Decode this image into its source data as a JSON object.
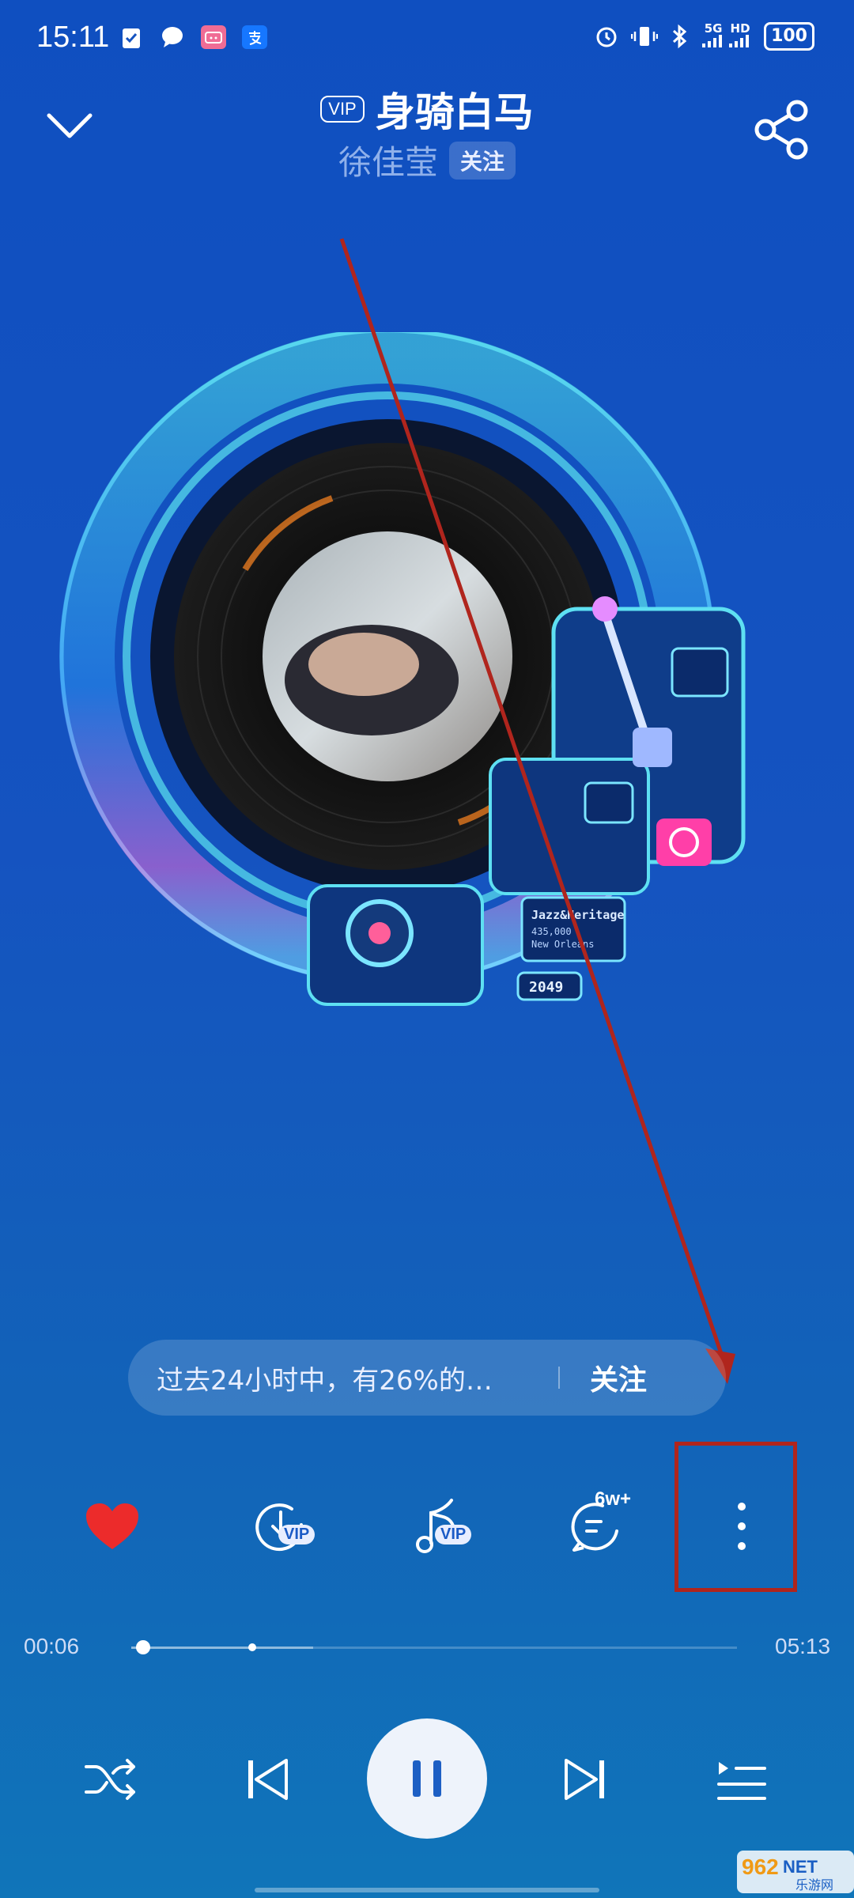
{
  "status_bar": {
    "time": "15:11",
    "network": "5G",
    "hd": "HD",
    "battery": "100"
  },
  "header": {
    "vip_badge": "VIP",
    "title": "身骑白马",
    "artist": "徐佳莹",
    "follow_label": "关注"
  },
  "info_bar": {
    "text": "过去24小时中，有26%的…",
    "follow_label": "关注"
  },
  "actions": {
    "download_vip": "VIP",
    "ringtone_vip": "VIP",
    "comment_count": "6w+"
  },
  "progress": {
    "current": "00:06",
    "total": "05:13",
    "played_fraction": 0.019,
    "buffered_fraction": 0.3
  },
  "album_labels": {
    "jazz_title": "Jazz&Heritage",
    "jazz_line1": "435,000",
    "jazz_line2": "New Orleans",
    "year": "2049"
  },
  "watermark": {
    "brand": "962",
    "net": "NET",
    "cn": "乐游网"
  },
  "colors": {
    "accent_red": "#ec2b2b",
    "annotation_red": "#b0251d",
    "background_top": "#0f4fc0",
    "background_bottom": "#1075b9"
  }
}
